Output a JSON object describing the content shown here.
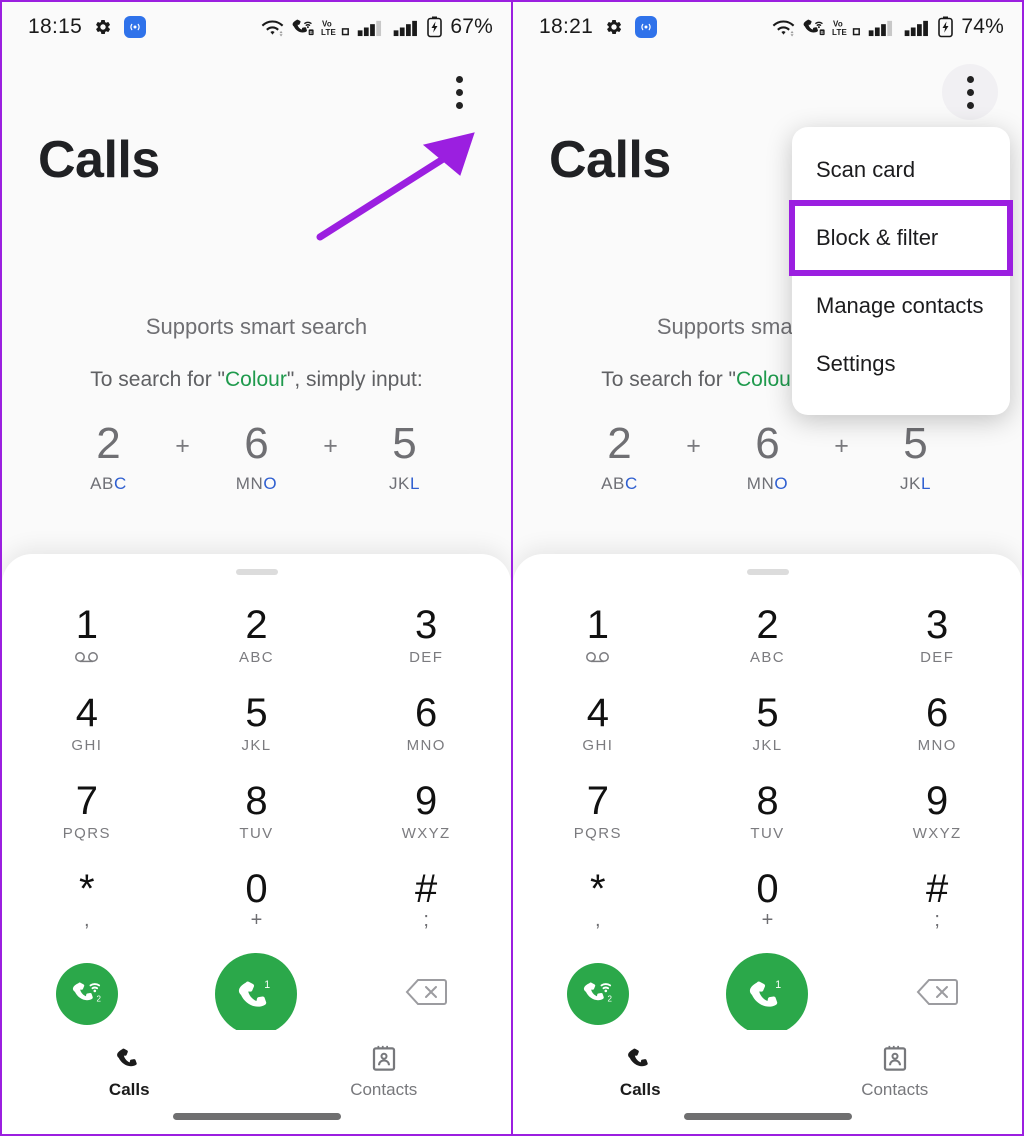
{
  "panels": [
    {
      "id": "left",
      "status": {
        "time": "18:15",
        "battery": "67%",
        "icons": [
          "gear-icon",
          "cast-icon",
          "wifi-icon",
          "call-wifi-icon",
          "volte-icon",
          "signal-icon-1",
          "signal-icon-2",
          "battery-icon"
        ]
      },
      "header": {
        "title": "Calls",
        "menu_button": "kebab-menu"
      },
      "hint": {
        "title": "Supports smart search",
        "prefix": "To search for \"",
        "word": "Colour",
        "suffix": "\", simply input:",
        "keys": [
          {
            "num": "2",
            "letters": "AB",
            "hl": "C"
          },
          {
            "num": "6",
            "letters": "MN",
            "hl": "O"
          },
          {
            "num": "5",
            "letters": "JK",
            "hl": "L"
          }
        ],
        "plus": "+"
      },
      "annotation": {
        "type": "arrow",
        "color": "#9B1FE0",
        "points_to": "kebab-menu"
      },
      "menu_open": false
    },
    {
      "id": "right",
      "status": {
        "time": "18:21",
        "battery": "74%",
        "icons": [
          "gear-icon",
          "cast-icon",
          "wifi-icon",
          "call-wifi-icon",
          "volte-icon",
          "signal-icon-1",
          "signal-icon-2",
          "battery-icon"
        ]
      },
      "header": {
        "title": "Calls",
        "menu_button": "kebab-menu"
      },
      "hint": {
        "title": "Supports smart search",
        "prefix": "To search for \"",
        "word": "Colour",
        "suffix": "\", simply input:",
        "keys": [
          {
            "num": "2",
            "letters": "AB",
            "hl": "C"
          },
          {
            "num": "6",
            "letters": "MN",
            "hl": "O"
          },
          {
            "num": "5",
            "letters": "JK",
            "hl": "L"
          }
        ],
        "plus": "+"
      },
      "menu_open": true,
      "menu": {
        "items": [
          {
            "label": "Scan card",
            "highlighted": false
          },
          {
            "label": "Block & filter",
            "highlighted": true
          },
          {
            "label": "Manage contacts",
            "highlighted": false
          },
          {
            "label": "Settings",
            "highlighted": false
          }
        ],
        "highlight_color": "#9B1FE0"
      }
    }
  ],
  "dialpad": {
    "keys": [
      {
        "digit": "1",
        "sub": "voicemail-icon",
        "is_icon": true
      },
      {
        "digit": "2",
        "sub": "ABC"
      },
      {
        "digit": "3",
        "sub": "DEF"
      },
      {
        "digit": "4",
        "sub": "GHI"
      },
      {
        "digit": "5",
        "sub": "JKL"
      },
      {
        "digit": "6",
        "sub": "MNO"
      },
      {
        "digit": "7",
        "sub": "PQRS"
      },
      {
        "digit": "8",
        "sub": "TUV"
      },
      {
        "digit": "9",
        "sub": "WXYZ"
      },
      {
        "digit": "*",
        "sub": ","
      },
      {
        "digit": "0",
        "sub": "+"
      },
      {
        "digit": "#",
        "sub": ";"
      }
    ],
    "actions": {
      "wifi_call_label": "wifi-call-button",
      "call_label": "call-button",
      "call_sim_badge": "1",
      "wifi_call_sim_badge": "2",
      "delete_label": "backspace-button"
    },
    "accent_green": "#2ba84a"
  },
  "nav": {
    "items": [
      {
        "label": "Calls",
        "icon": "phone-icon",
        "selected": true
      },
      {
        "label": "Contacts",
        "icon": "contacts-icon",
        "selected": false
      }
    ]
  },
  "theme": {
    "annotation_purple": "#9B1FE0",
    "highlight_blue": "#2f5fd0",
    "highlight_green": "#1f9a4d",
    "page_bg": "#fafafa",
    "sheet_bg": "#ffffff"
  }
}
